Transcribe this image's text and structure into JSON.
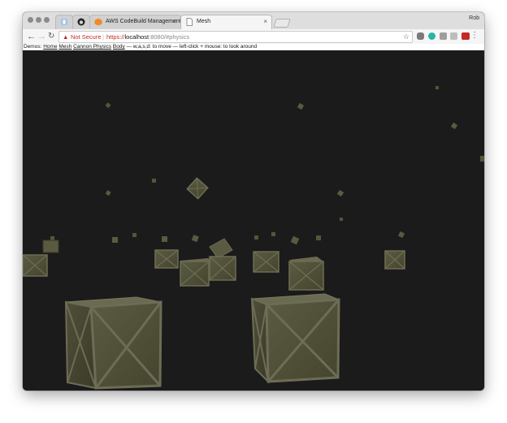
{
  "browser": {
    "profile_name": "Rob",
    "tabs": [
      {
        "label": "",
        "icon": "extension-icon"
      },
      {
        "label": "",
        "icon": "github-icon"
      },
      {
        "label": "AWS CodeBuild Management",
        "icon": "aws-icon"
      },
      {
        "label": "Mesh",
        "icon": "page-icon",
        "active": true
      }
    ],
    "security_label": "Not Secure",
    "url": {
      "scheme": "https://",
      "host": "localhost",
      "path": ":8080/#physics"
    }
  },
  "page": {
    "demos_label": "Demos:",
    "links": [
      "Home",
      "Mesh",
      "Cannon Physics",
      "Body"
    ],
    "help_text": "— w,a,s,d: to move — left-click + mouse: to look around"
  },
  "colors": {
    "background": "#1b1b1b",
    "crate_face": "#55553c",
    "crate_plank": "#6d6c55",
    "warning_red": "#c62828"
  }
}
